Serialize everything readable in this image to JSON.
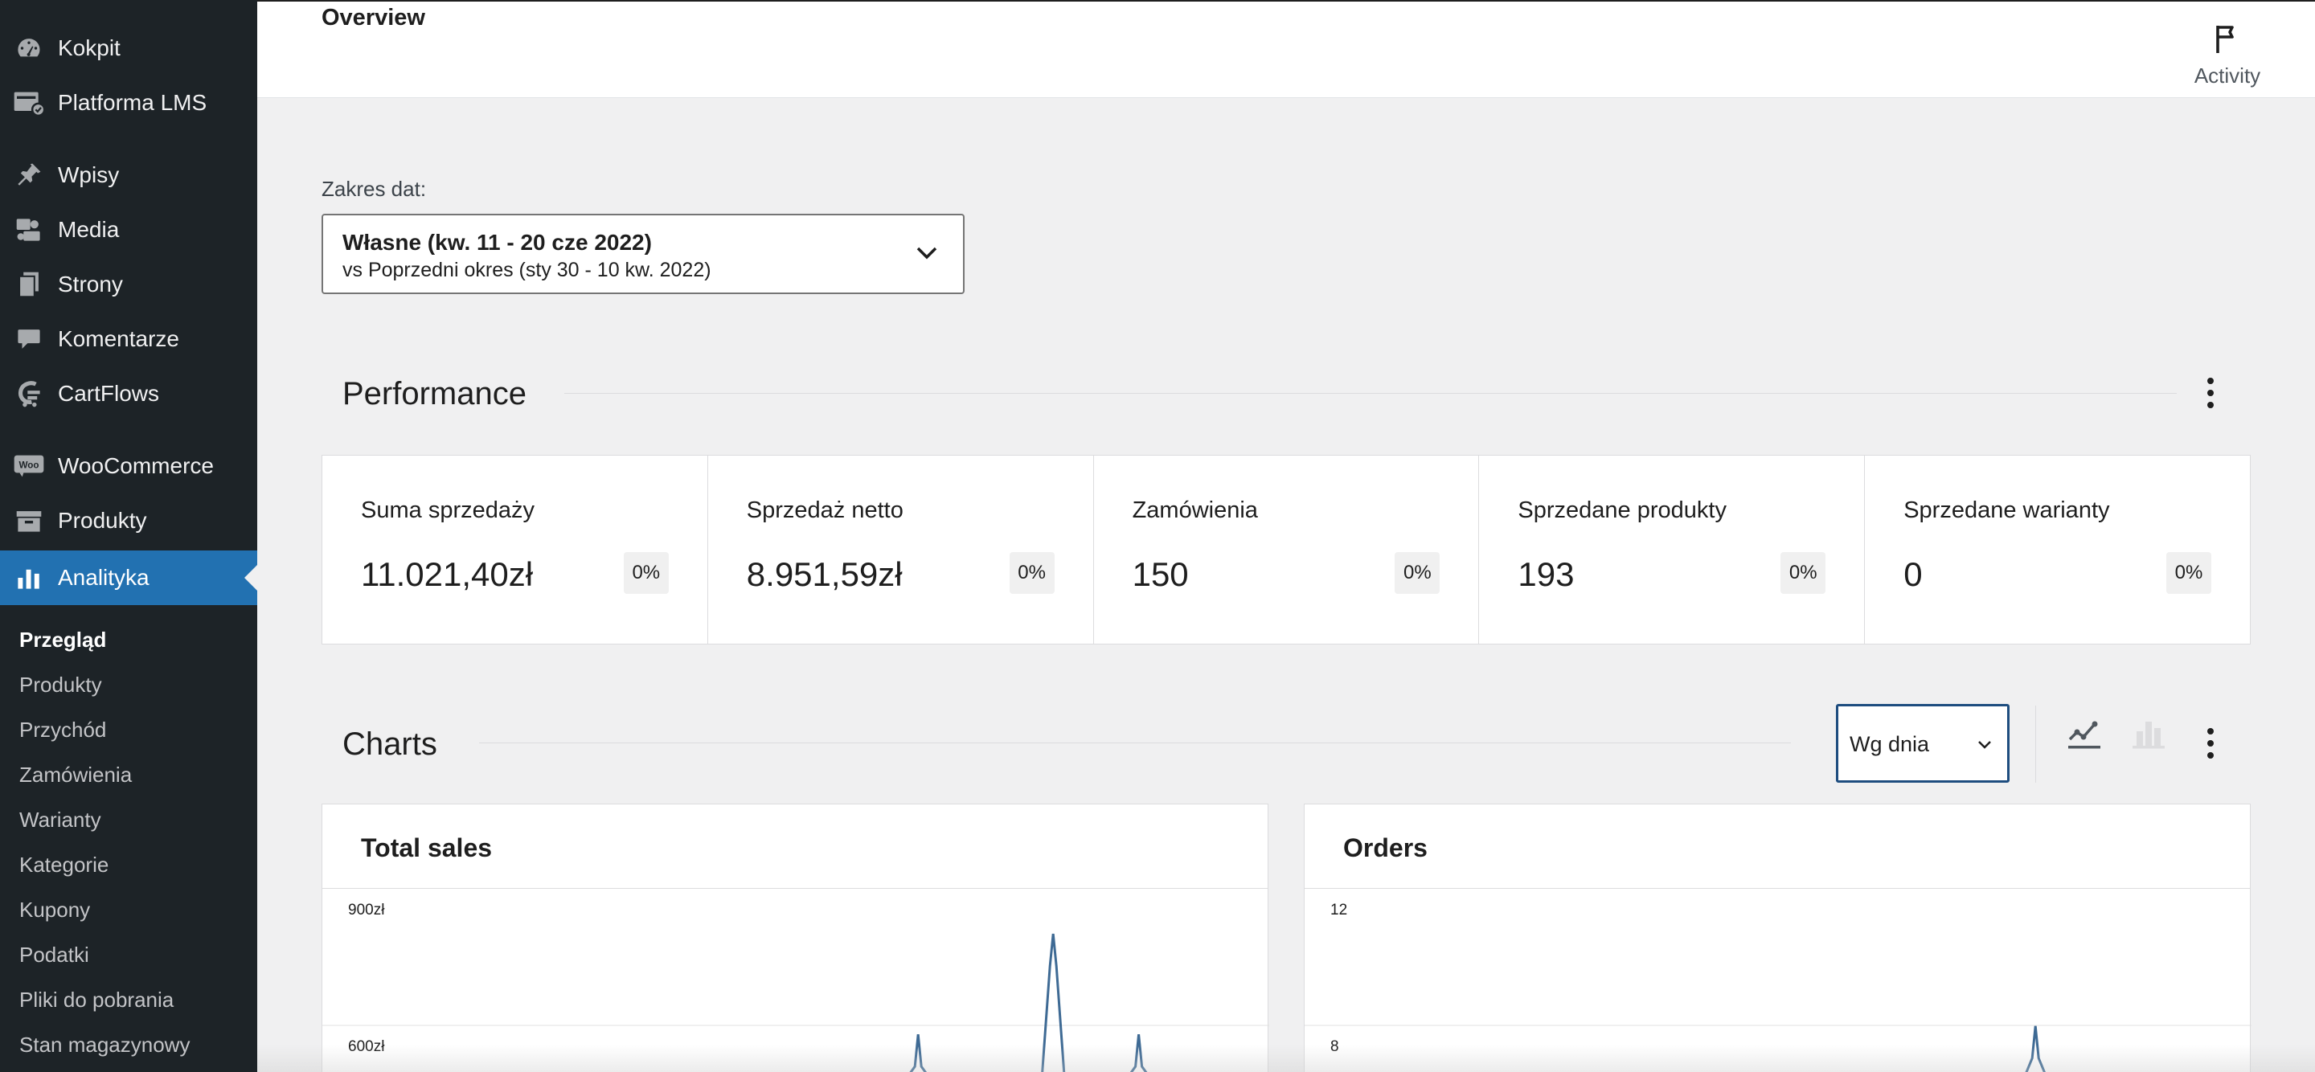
{
  "sidebar": {
    "items": [
      {
        "label": "Kokpit",
        "icon": "dashboard-icon"
      },
      {
        "label": "Platforma LMS",
        "icon": "lms-icon"
      },
      {
        "label": "Wpisy",
        "icon": "pin-icon"
      },
      {
        "label": "Media",
        "icon": "media-icon"
      },
      {
        "label": "Strony",
        "icon": "pages-icon"
      },
      {
        "label": "Komentarze",
        "icon": "comment-icon"
      },
      {
        "label": "CartFlows",
        "icon": "cartflows-icon"
      },
      {
        "label": "WooCommerce",
        "icon": "woo-icon"
      },
      {
        "label": "Produkty",
        "icon": "archive-icon"
      },
      {
        "label": "Analityka",
        "icon": "bar-chart-icon"
      }
    ],
    "submenu": [
      "Przegląd",
      "Produkty",
      "Przychód",
      "Zamówienia",
      "Warianty",
      "Kategorie",
      "Kupony",
      "Podatki",
      "Pliki do pobrania",
      "Stan magazynowy"
    ],
    "woo_badge": "Woo",
    "colors": {
      "bg": "#1d2327",
      "active": "#2271b1",
      "text": "#f0f0f1"
    }
  },
  "header": {
    "title": "Overview",
    "activity_label": "Activity"
  },
  "date_range": {
    "label": "Zakres dat:",
    "primary": "Własne (kw. 11 - 20 cze 2022)",
    "secondary": "vs Poprzedni okres (sty 30 - 10 kw. 2022)"
  },
  "performance": {
    "title": "Performance",
    "tiles": [
      {
        "label": "Suma sprzedaży",
        "value": "11.021,40zł",
        "delta": "0%"
      },
      {
        "label": "Sprzedaż netto",
        "value": "8.951,59zł",
        "delta": "0%"
      },
      {
        "label": "Zamówienia",
        "value": "150",
        "delta": "0%"
      },
      {
        "label": "Sprzedane produkty",
        "value": "193",
        "delta": "0%"
      },
      {
        "label": "Sprzedane warianty",
        "value": "0",
        "delta": "0%"
      }
    ]
  },
  "charts": {
    "title": "Charts",
    "interval": "Wg dnia",
    "accent": "#1e4d7f",
    "line_color": "#3e6a94"
  },
  "chart_data": [
    {
      "type": "line",
      "title": "Total sales",
      "yticks": [
        "900zł",
        "600zł"
      ],
      "ylim": [
        300,
        1000
      ],
      "points": [
        [
          0.0,
          300
        ],
        [
          0.38,
          300
        ],
        [
          0.5,
          300
        ],
        [
          0.58,
          300
        ],
        [
          0.6,
          700
        ],
        [
          0.61,
          300
        ],
        [
          0.65,
          300
        ],
        [
          0.68,
          300
        ],
        [
          0.7,
          500
        ],
        [
          0.74,
          300
        ],
        [
          0.78,
          300
        ],
        [
          1.0,
          300
        ]
      ],
      "spikes": [
        {
          "x": 0.635,
          "y": 610
        },
        {
          "x": 0.785,
          "y": 850
        },
        {
          "x": 0.88,
          "y": 610
        }
      ]
    },
    {
      "type": "line",
      "title": "Orders",
      "yticks": [
        "12",
        "8"
      ],
      "ylim": [
        4,
        13
      ],
      "spikes": [
        {
          "x": 0.785,
          "y": 8.4
        }
      ]
    }
  ]
}
